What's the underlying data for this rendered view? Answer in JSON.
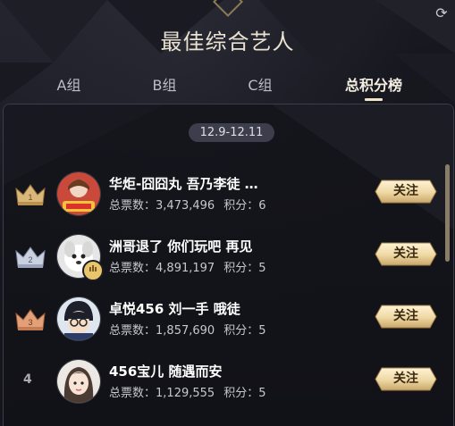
{
  "title": "最佳综合艺人",
  "tabs": [
    {
      "label": "A组",
      "active": false
    },
    {
      "label": "B组",
      "active": false
    },
    {
      "label": "C组",
      "active": false
    },
    {
      "label": "总积分榜",
      "active": true
    }
  ],
  "date_range": "12.9-12.11",
  "labels": {
    "votes": "总票数：",
    "points": "积分："
  },
  "follow_label": "关注",
  "colors": {
    "gold": "#d9b77a",
    "silver": "#b9c2d6",
    "bronze": "#d9916a",
    "button_gold": "#f2dfb4"
  },
  "rows": [
    {
      "rank": "1",
      "rank_icon": "crown-gold-icon",
      "name": "华炬-囧囧丸 吾乃李徒 …",
      "votes": "3,473,496",
      "points": "6"
    },
    {
      "rank": "2",
      "rank_icon": "crown-silver-icon",
      "name": "洲哥退了 你们玩吧 再见",
      "votes": "4,891,197",
      "points": "5"
    },
    {
      "rank": "3",
      "rank_icon": "crown-bronze-icon",
      "name": "卓悦456 刘一手 哦徒",
      "votes": "1,857,690",
      "points": "5"
    },
    {
      "rank": "4",
      "rank_icon": "",
      "name": "456宝儿 随遇而安",
      "votes": "1,129,555",
      "points": "5"
    }
  ]
}
